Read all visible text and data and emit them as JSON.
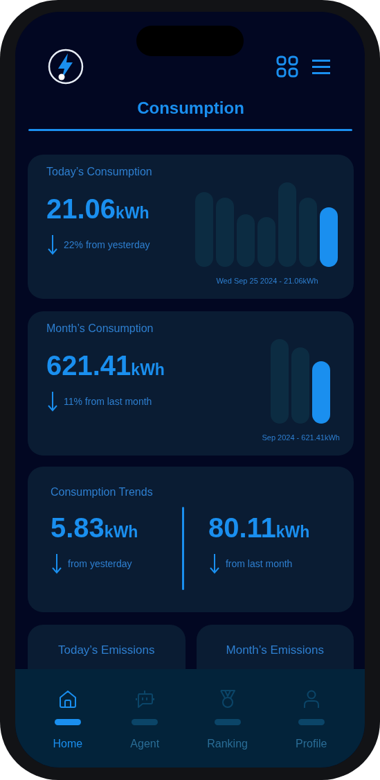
{
  "header": {
    "title": "Consumption"
  },
  "summaries": [
    {
      "title": "Today’s Consumption",
      "value": "21.06",
      "unit": "kWh",
      "change": "22% from yesterday",
      "caption": "Wed Sep 25 2024 - 21.06kWh",
      "kind": "daily"
    },
    {
      "title": "Month’s Consumption",
      "value": "621.41",
      "unit": "kWh",
      "change": "11% from last month",
      "caption": "Sep 2024 - 621.41kWh",
      "kind": "monthly"
    }
  ],
  "trends": {
    "title": "Consumption Trends",
    "items": [
      {
        "value": "5.83",
        "unit": "kWh",
        "label": "from yesterday"
      },
      {
        "value": "80.11",
        "unit": "kWh",
        "label": "from last month"
      }
    ]
  },
  "emissions": [
    {
      "title": "Today’s Emissions"
    },
    {
      "title": "Month’s Emissions"
    }
  ],
  "tab_bar": [
    {
      "label": "Home",
      "kind": "home",
      "selected": true
    },
    {
      "label": "Agent",
      "kind": "agent",
      "selected": false
    },
    {
      "label": "Ranking",
      "kind": "ranking",
      "selected": false
    },
    {
      "label": "Profile",
      "kind": "profile",
      "selected": false
    }
  ]
}
